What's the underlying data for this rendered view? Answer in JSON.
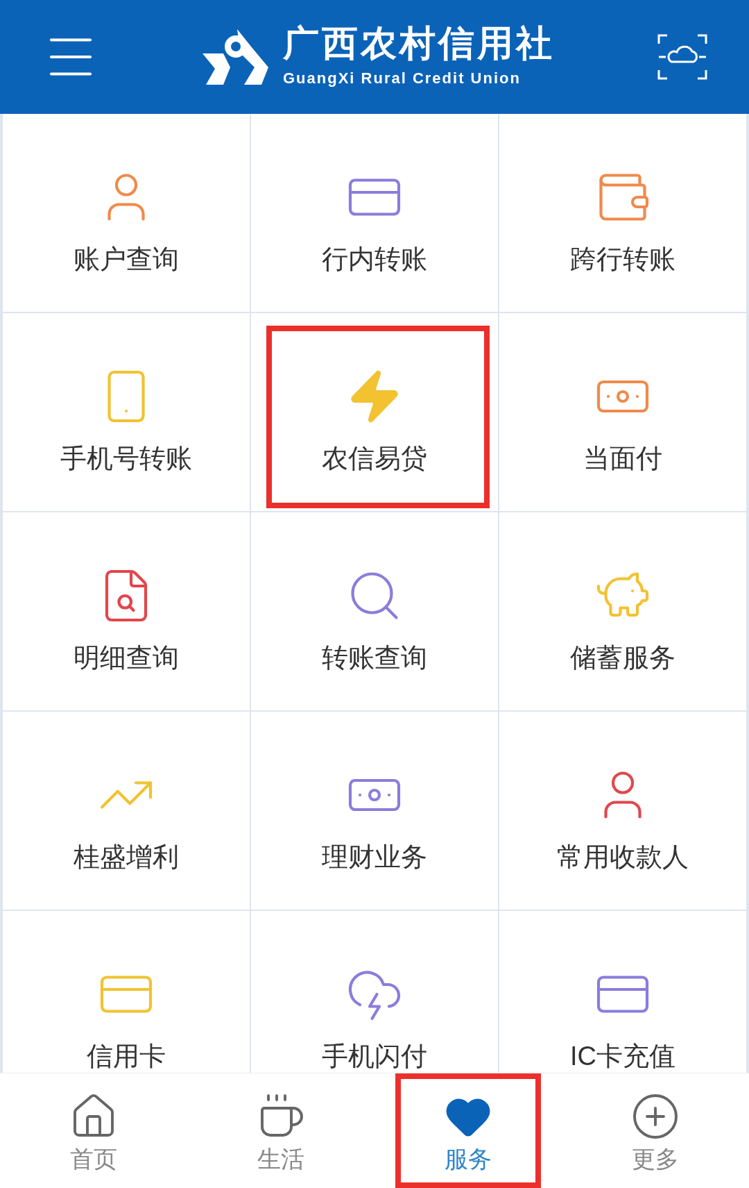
{
  "header": {
    "brand_name": "广西农村信用社",
    "brand_subtitle": "GuangXi Rural Credit Union"
  },
  "services": [
    {
      "label": "账户查询",
      "highlighted": false
    },
    {
      "label": "行内转账",
      "highlighted": false
    },
    {
      "label": "跨行转账",
      "highlighted": false
    },
    {
      "label": "手机号转账",
      "highlighted": false
    },
    {
      "label": "农信易贷",
      "highlighted": true
    },
    {
      "label": "当面付",
      "highlighted": false
    },
    {
      "label": "明细查询",
      "highlighted": false
    },
    {
      "label": "转账查询",
      "highlighted": false
    },
    {
      "label": "储蓄服务",
      "highlighted": false
    },
    {
      "label": "桂盛增利",
      "highlighted": false
    },
    {
      "label": "理财业务",
      "highlighted": false
    },
    {
      "label": "常用收款人",
      "highlighted": false
    },
    {
      "label": "信用卡",
      "highlighted": false
    },
    {
      "label": "手机闪付",
      "highlighted": false
    },
    {
      "label": "IC卡充值",
      "highlighted": false
    }
  ],
  "tabs": [
    {
      "label": "首页",
      "selected": false,
      "highlighted": false
    },
    {
      "label": "生活",
      "selected": false,
      "highlighted": false
    },
    {
      "label": "服务",
      "selected": true,
      "highlighted": true
    },
    {
      "label": "更多",
      "selected": false,
      "highlighted": false
    }
  ]
}
